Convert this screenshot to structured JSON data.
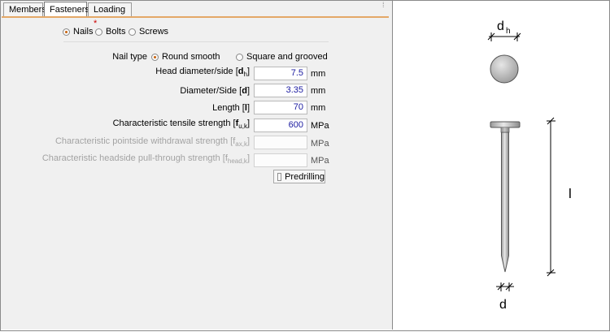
{
  "tabs": [
    {
      "label": "Members",
      "modified": false
    },
    {
      "label": "Fasteners",
      "modified": false,
      "active": true
    },
    {
      "label": "Loading",
      "modified": true,
      "marker": "*"
    }
  ],
  "fastener_type": {
    "options": [
      "Nails",
      "Bolts",
      "Screws"
    ],
    "selected": "Nails"
  },
  "nail_type": {
    "label": "Nail type",
    "options": [
      "Round smooth",
      "Square and grooved"
    ],
    "selected": "Round smooth"
  },
  "fields": [
    {
      "label": "Head diameter/side [",
      "sym": "d",
      "sub": "h",
      "tail": "]",
      "value": "7.5",
      "unit": "mm",
      "enabled": true
    },
    {
      "label": "Diameter/Side [",
      "sym": "d",
      "sub": "",
      "tail": "]",
      "value": "3.35",
      "unit": "mm",
      "enabled": true
    },
    {
      "label": "Length [",
      "sym": "l",
      "sub": "",
      "tail": "]",
      "value": "70",
      "unit": "mm",
      "enabled": true
    },
    {
      "label": "Characteristic tensile strength [",
      "sym": "f",
      "sub": "u,k",
      "tail": "]",
      "value": "600",
      "unit": "MPa",
      "enabled": true
    },
    {
      "label": "Characteristic pointside withdrawal strength [",
      "sym": "f",
      "sub": "ax,k",
      "tail": "]",
      "value": "",
      "unit": "MPa",
      "enabled": false
    },
    {
      "label": "Characteristic headside pull-through strength [",
      "sym": "f",
      "sub": "head,k",
      "tail": "]",
      "value": "",
      "unit": "MPa",
      "enabled": false
    }
  ],
  "predrilling": {
    "label": "Predrilling",
    "checked": false
  },
  "diagram": {
    "head_dim": {
      "main": "d",
      "sub": "h"
    },
    "length_label": "l",
    "diameter_label": "d"
  },
  "colors": {
    "accent": "#c7610b",
    "tab_underline": "#e4a867",
    "value_text": "#1a1aa0"
  }
}
